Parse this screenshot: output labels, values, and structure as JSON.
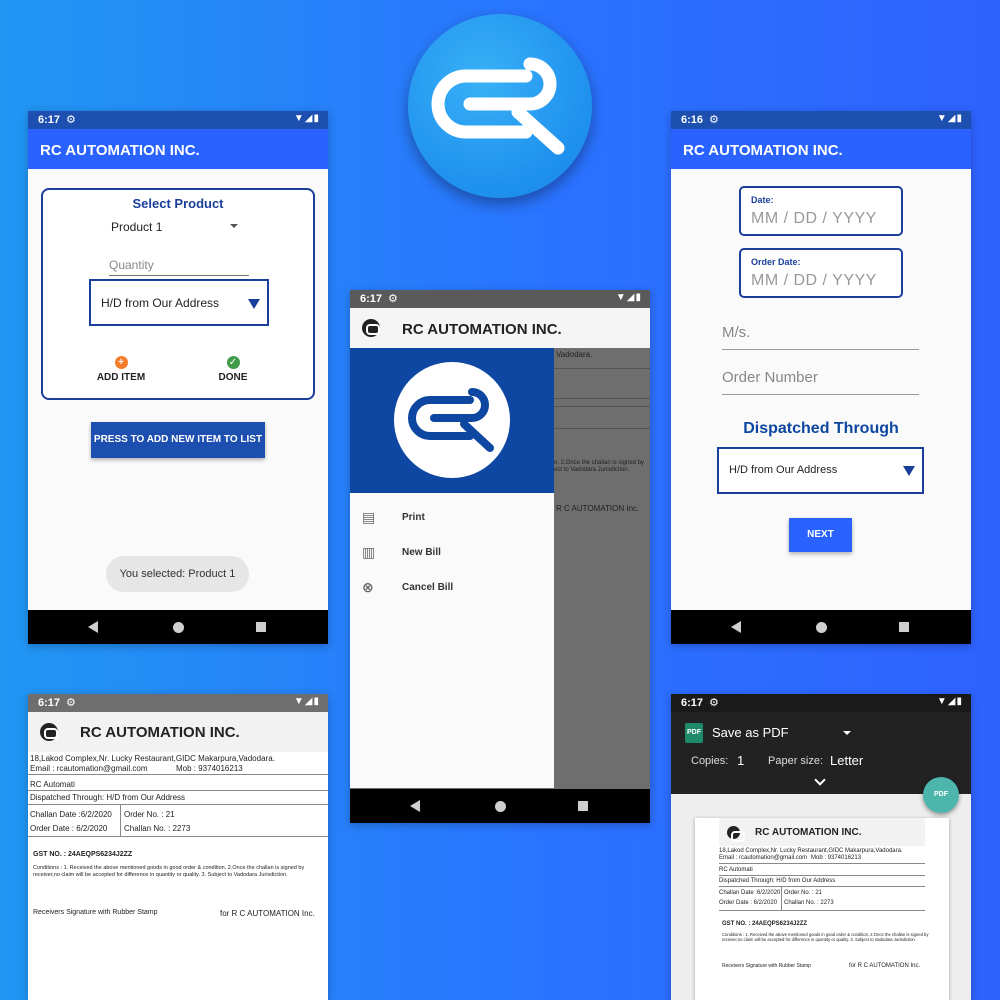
{
  "app": {
    "title": "RC AUTOMATION INC."
  },
  "status": {
    "time1": "6:17",
    "time3": "6:16",
    "gear": "⚙",
    "sys": "▼◢▮"
  },
  "screen_product": {
    "card_title": "Select Product",
    "product_value": "Product 1",
    "quantity_placeholder": "Quantity",
    "dispatch_value": "H/D from Our Address",
    "add_item_label": "ADD ITEM",
    "done_label": "DONE",
    "add_new_button": "PRESS TO ADD NEW ITEM TO LIST",
    "toast": "You selected: Product 1"
  },
  "screen_drawer": {
    "menu": [
      {
        "icon": "printer-icon",
        "label": "Print"
      },
      {
        "icon": "new-bill-icon",
        "label": "New Bill"
      },
      {
        "icon": "cancel-icon",
        "label": "Cancel Bill"
      }
    ],
    "bg_text_top": "Vadodara.",
    "bg_text_terms": "n. 2.Once the challan is signed by\nect to Vadodara Jurisdiction.",
    "bg_text_sig": "R C AUTOMATION Inc."
  },
  "screen_form": {
    "date_label": "Date:",
    "date_placeholder": "MM / DD / YYYY",
    "order_date_label": "Order Date:",
    "order_date_placeholder": "MM / DD / YYYY",
    "ms_placeholder": "M/s.",
    "order_number_placeholder": "Order Number",
    "dispatched_title": "Dispatched Through",
    "dispatch_value": "H/D from Our Address",
    "next_button": "NEXT"
  },
  "challan": {
    "address": "18,Lakod Complex,Nr. Lucky Restaurant,GIDC Makarpura,Vadodara.",
    "email": "Email : rcautomation@gmail.com",
    "mob": "Mob : 9374016213",
    "customer": "RC Automati",
    "dispatched": "Dispatched Through:   H/D from Our Address",
    "challan_date": "Challan Date :6/2/2020",
    "order_no": "Order No. : 21",
    "order_date": "Order Date :  6/2/2020",
    "challan_no": "Challan No. : 2273",
    "gst": "GST NO. : 24AEQPS6234J2ZZ",
    "conditions_1": "Conditions : 1. Received the above mentioned goods in good order & condition.  2.Once the challan is signed by",
    "conditions_2": "receiver,no claim will be accepted for difference in quantity or quality.  3. Subject to Vadodara Jurisdiction.",
    "receiver_sig": "Receivers Signature with Rubber Stamp",
    "company_sig": "for R C AUTOMATION Inc."
  },
  "screen_print": {
    "destination": "Save as PDF",
    "copies_label": "Copies:",
    "copies_value": "1",
    "paper_label": "Paper size:",
    "paper_value": "Letter",
    "pdf_badge": "PDF"
  }
}
